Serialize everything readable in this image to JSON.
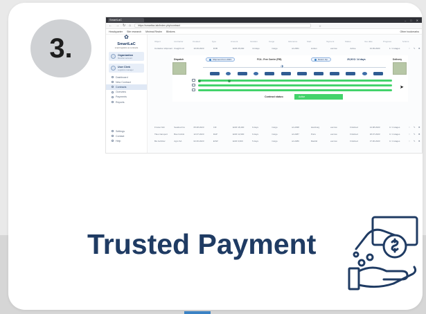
{
  "step": {
    "number": "3."
  },
  "headline": "Trusted Payment",
  "colors": {
    "accent": "#1f3b63",
    "badge": "#cfd1d4",
    "progress": "#43d36b"
  },
  "browser": {
    "tab_title": "SmartLaC",
    "url": "https://smartlac.lab/index.php/contract",
    "bookmarks": [
      "Headquarter",
      "Site research",
      "Minimal Realm",
      "Blinkers"
    ],
    "other_bookmarks": "Other bookmarks"
  },
  "app": {
    "logo": "SmartLaC",
    "logo_sub": "smart logistics as contracts",
    "account_1": {
      "title": "Organization",
      "sub": "Member account"
    },
    "account_2": {
      "title": "User Clerk",
      "sub": "Logistics manager"
    },
    "menu": [
      "Dashboard",
      "New Contract",
      "Contracts",
      "Overview",
      "Payments",
      "Reports"
    ],
    "bottom_menu": [
      "Settings",
      "Contact",
      "Help"
    ],
    "table": {
      "headers": [
        "Object",
        "Contractor",
        "Created",
        "Type",
        "Amount",
        "Duration",
        "Cargo",
        "Reference",
        "Start",
        "Payment",
        "Status",
        "Due date",
        "Progress",
        "Actions"
      ],
      "rows": [
        [
          "Container shipment",
          "Freight Ltd",
          "10.09.2023",
          "FOB",
          "EUR 25,000",
          "14 days",
          "Cargo",
          "ref-2301",
          "Lisbon",
          "escrow",
          "Active",
          "24.09.2023",
          "1 / 4 stages",
          "3 stages"
        ],
        [
          "Frozen fish",
          "Seafood Co",
          "05.08.2023",
          "CIF",
          "EUR 18,400",
          "9 days",
          "Cargo",
          "ref-2298",
          "Hamburg",
          "escrow",
          "Finished",
          "14.08.2023",
          "4 / 4 stages",
          "4 stages"
        ],
        [
          "Tiles transport",
          "Bau GmbH",
          "12.07.2023",
          "DAP",
          "EUR 12,900",
          "6 days",
          "Cargo",
          "ref-2287",
          "Porto",
          "escrow",
          "Finished",
          "18.07.2023",
          "4 / 4 stages",
          "4 stages"
        ],
        [
          "Bio fertilizer",
          "Agro SA",
          "02.06.2023",
          "EXW",
          "EUR 9,600",
          "5 days",
          "Cargo",
          "ref-2280",
          "Madrid",
          "escrow",
          "Finished",
          "07.06.2023",
          "4 / 4 stages",
          "4 stages"
        ]
      ]
    },
    "contract": {
      "origin": "Dispatch",
      "destination": "Delivery",
      "pill_left": "Shipment from 2023",
      "route": "FCA - Free Carrier (FIB)",
      "pill_right": "Return trip",
      "price": "25,00 $ / 14 days",
      "status_label": "Contract status:",
      "status_value": "Active"
    }
  }
}
